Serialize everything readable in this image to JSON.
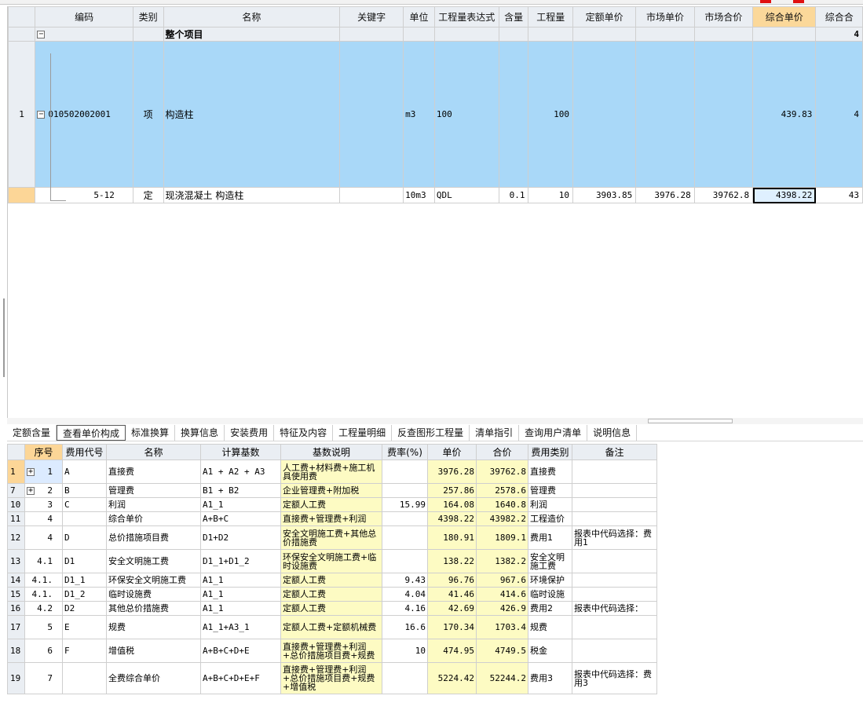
{
  "main_grid": {
    "columns": [
      "编码",
      "类别",
      "名称",
      "关键字",
      "单位",
      "工程量表达式",
      "含量",
      "工程量",
      "定额单价",
      "市场单价",
      "市场合价",
      "综合单价",
      "综合合"
    ],
    "group_row": {
      "label": "整个项目",
      "trailing": "4"
    },
    "rows": [
      {
        "rownum": "1",
        "code": "010502002001",
        "category": "项",
        "name": "构造柱",
        "keyword": "",
        "unit": "m3",
        "expr": "100",
        "content": "",
        "qty": "100",
        "quota_price": "",
        "market_price": "",
        "market_total": "",
        "unit_price": "439.83",
        "unit_total": "4"
      },
      {
        "rownum": "",
        "code": "5-12",
        "category": "定",
        "name": "现浇混凝土 构造柱",
        "keyword": "",
        "unit": "10m3",
        "expr": "QDL",
        "content": "0.1",
        "qty": "10",
        "quota_price": "3903.85",
        "market_price": "3976.28",
        "market_total": "39762.8",
        "unit_price": "4398.22",
        "unit_total": "43"
      }
    ]
  },
  "tabs": [
    "定额含量",
    "查看单价构成",
    "标准换算",
    "换算信息",
    "安装费用",
    "特征及内容",
    "工程量明细",
    "反查图形工程量",
    "清单指引",
    "查询用户清单",
    "说明信息"
  ],
  "active_tab": "查看单价构成",
  "cost_grid": {
    "columns": [
      "",
      "序号",
      "费用代号",
      "名称",
      "计算基数",
      "基数说明",
      "费率(%)",
      "单价",
      "合价",
      "费用类别",
      "备注"
    ],
    "rows": [
      {
        "rownum": "1",
        "seq": "1",
        "code": "A",
        "name": "直接费",
        "base": "A1 + A2 + A3",
        "desc": "人工费+材料费+施工机具使用费",
        "rate": "",
        "price": "3976.28",
        "total": "39762.8",
        "type": "直接费",
        "note": "",
        "expand": "+"
      },
      {
        "rownum": "7",
        "seq": "2",
        "code": "B",
        "name": "管理费",
        "base": "B1 + B2",
        "desc": "企业管理费+附加税",
        "rate": "",
        "price": "257.86",
        "total": "2578.6",
        "type": "管理费",
        "note": "",
        "expand": "+"
      },
      {
        "rownum": "10",
        "seq": "3",
        "code": "C",
        "name": "利润",
        "base": "A1_1",
        "desc": "定额人工费",
        "rate": "15.99",
        "price": "164.08",
        "total": "1640.8",
        "type": "利润",
        "note": "",
        "expand": ""
      },
      {
        "rownum": "11",
        "seq": "4",
        "code": "",
        "name": "综合单价",
        "base": "A+B+C",
        "desc": "直接费+管理费+利润",
        "rate": "",
        "price": "4398.22",
        "total": "43982.2",
        "type": "工程造价",
        "note": "",
        "expand": ""
      },
      {
        "rownum": "12",
        "seq": "4",
        "code": "D",
        "name": "总价措施项目费",
        "base": "D1+D2",
        "desc": "安全文明施工费+其他总价措施费",
        "rate": "",
        "price": "180.91",
        "total": "1809.1",
        "type": "费用1",
        "note": "报表中代码选择：费用1",
        "expand": ""
      },
      {
        "rownum": "13",
        "seq": "4.1",
        "code": "D1",
        "name": "安全文明施工费",
        "base": "D1_1+D1_2",
        "desc": "环保安全文明施工费+临时设施费",
        "rate": "",
        "price": "138.22",
        "total": "1382.2",
        "type": "安全文明施工费",
        "note": "",
        "expand": ""
      },
      {
        "rownum": "14",
        "seq": "4.1.",
        "code": "D1_1",
        "name": "环保安全文明施工费",
        "base": "A1_1",
        "desc": "定额人工费",
        "rate": "9.43",
        "price": "96.76",
        "total": "967.6",
        "type": "环境保护",
        "note": "",
        "expand": ""
      },
      {
        "rownum": "15",
        "seq": "4.1.",
        "code": "D1_2",
        "name": "临时设施费",
        "base": "A1_1",
        "desc": "定额人工费",
        "rate": "4.04",
        "price": "41.46",
        "total": "414.6",
        "type": "临时设施",
        "note": "",
        "expand": ""
      },
      {
        "rownum": "16",
        "seq": "4.2",
        "code": "D2",
        "name": "其他总价措施费",
        "base": "A1_1",
        "desc": "定额人工费",
        "rate": "4.16",
        "price": "42.69",
        "total": "426.9",
        "type": "费用2",
        "note": "报表中代码选择：",
        "expand": ""
      },
      {
        "rownum": "17",
        "seq": "5",
        "code": "E",
        "name": "规费",
        "base": "A1_1+A3_1",
        "desc": "定额人工费+定额机械费",
        "rate": "16.6",
        "price": "170.34",
        "total": "1703.4",
        "type": "规费",
        "note": "",
        "expand": ""
      },
      {
        "rownum": "18",
        "seq": "6",
        "code": "F",
        "name": "增值税",
        "base": "A+B+C+D+E",
        "desc": "直接费+管理费+利润+总价措施项目费+规费",
        "rate": "10",
        "price": "474.95",
        "total": "4749.5",
        "type": "税金",
        "note": "",
        "expand": ""
      },
      {
        "rownum": "19",
        "seq": "7",
        "code": "",
        "name": "全费综合单价",
        "base": "A+B+C+D+E+F",
        "desc": "直接费+管理费+利润+总价措施项目费+规费+增值税",
        "rate": "",
        "price": "5224.42",
        "total": "52244.2",
        "type": "费用3",
        "note": "报表中代码选择：费用3",
        "expand": ""
      }
    ]
  },
  "colors": {
    "selected_row": "#a9d8f8",
    "header_bg": "#eaeef3",
    "active_header": "#fbd89a",
    "yellow_cell": "#fdfbc3"
  }
}
